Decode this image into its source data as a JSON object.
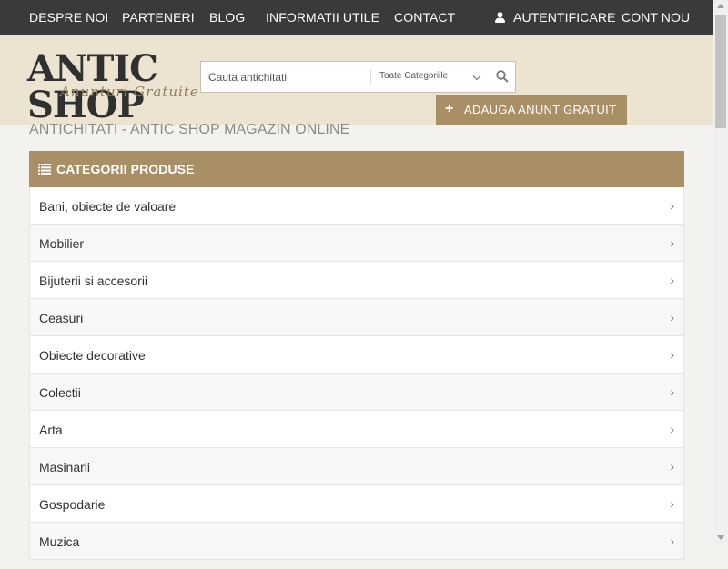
{
  "topnav": {
    "items": [
      {
        "label": "DESPRE NOI"
      },
      {
        "label": "PARTENERI"
      },
      {
        "label": "BLOG"
      },
      {
        "label": "INFORMATII UTILE"
      },
      {
        "label": "CONTACT"
      }
    ],
    "login_label": "AUTENTIFICARE",
    "register_label": "CONT NOU",
    "user_icon": "user-icon"
  },
  "logo": {
    "main_text": "ANTIC SHOP",
    "sub_text": "Anunturi Gratuite"
  },
  "search": {
    "placeholder": "Cauta antichitati",
    "category": "Toate Categoriile",
    "icon": "search-icon"
  },
  "add_button": {
    "label": "ADAUGA ANUNT GRATUIT",
    "icon": "plus-icon"
  },
  "page_heading": "ANTICHITATI - ANTIC SHOP MAGAZIN ONLINE",
  "categories": {
    "title": "CATEGORII PRODUSE",
    "icon": "list-icon",
    "items": [
      {
        "label": "Bani, obiecte de valoare"
      },
      {
        "label": "Mobilier"
      },
      {
        "label": "Bijuterii si accesorii"
      },
      {
        "label": "Ceasuri"
      },
      {
        "label": "Obiecte decorative"
      },
      {
        "label": "Colectii"
      },
      {
        "label": "Arta"
      },
      {
        "label": "Masinarii"
      },
      {
        "label": "Gospodarie"
      },
      {
        "label": "Muzica"
      }
    ]
  },
  "colors": {
    "topbar": "#3a3a3a",
    "header_bg": "#ece4d1",
    "accent": "#a88f65"
  }
}
